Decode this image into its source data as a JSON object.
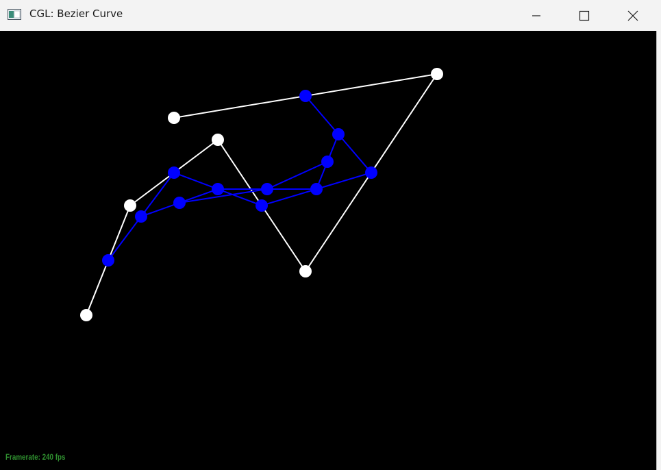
{
  "window": {
    "title": "CGL: Bezier Curve"
  },
  "status": {
    "framerate": "Framerate: 240 fps"
  },
  "colors": {
    "background": "#000000",
    "control_color": "#ffffff",
    "intermediate_color": "#0000ff",
    "framerate_color": "#2f8f2f"
  },
  "icons": [
    "app-icon",
    "minimize-icon",
    "maximize-icon",
    "close-icon"
  ]
}
